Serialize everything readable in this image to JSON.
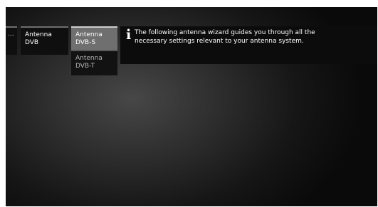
{
  "menu": {
    "ellipsis": "...",
    "antenna_dvb": "Antenna DVB",
    "antenna_dvbs": "Antenna DVB-S",
    "antenna_dvbt": "Antenna DVB-T"
  },
  "info": {
    "icon": "info-icon",
    "text": "The following antenna wizard guides you through all the necessary settings relevant to your antenna system."
  }
}
